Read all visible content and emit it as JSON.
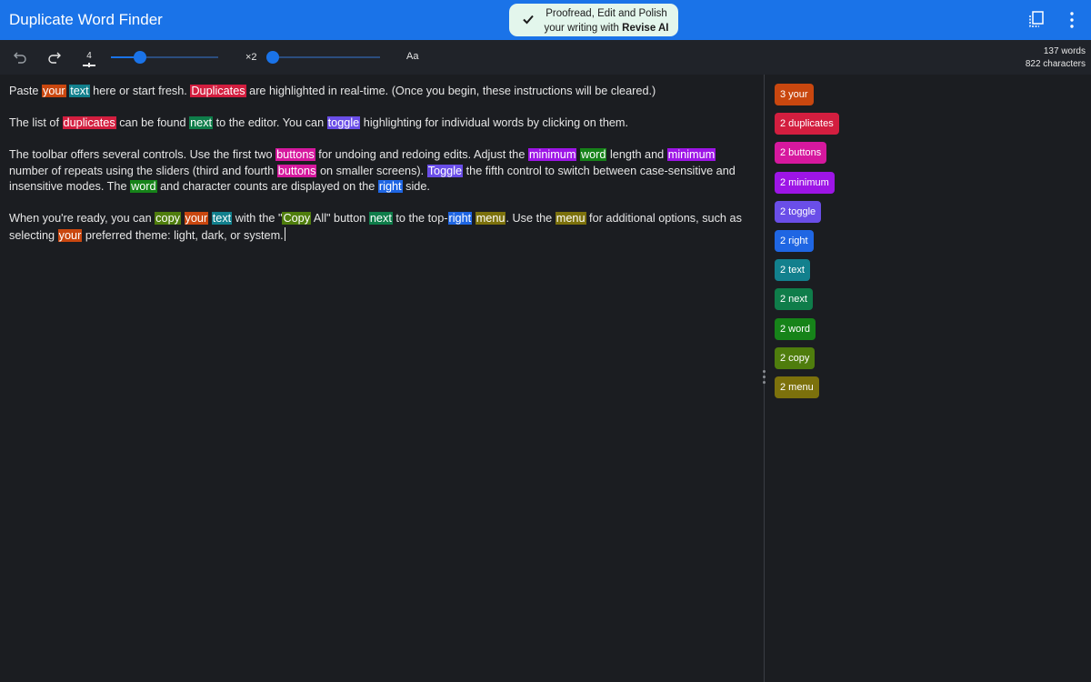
{
  "app": {
    "title": "Duplicate Word Finder"
  },
  "promo": {
    "line1": "Proofread, Edit and Polish",
    "line2_prefix": "your writing with ",
    "line2_brand": "Revise AI"
  },
  "header": {
    "icons": [
      "copy-all-icon",
      "more-vert-icon"
    ]
  },
  "toolbar": {
    "min_word_length": "4",
    "min_word_length_fraction": 0.27,
    "repeat_label": "×2",
    "min_repeats_fraction": 0.0,
    "case_toggle_label": "Aa",
    "word_count": "137 words",
    "char_count": "822 characters"
  },
  "colors": {
    "your": "#c9470f",
    "duplicates": "#d31e3f",
    "buttons": "#d6189e",
    "minimum": "#9d15e6",
    "toggle": "#6a4ee8",
    "right": "#1f66e3",
    "text": "#12808d",
    "next": "#0f7d4a",
    "word": "#168319",
    "copy": "#4f7d0d",
    "menu": "#7c710c",
    "header": "#1a73e8",
    "background": "#1b1d21"
  },
  "editor": {
    "paragraphs": [
      [
        {
          "t": "Paste "
        },
        {
          "t": "your",
          "w": "your"
        },
        {
          "t": " "
        },
        {
          "t": "text",
          "w": "text"
        },
        {
          "t": " here or start fresh. "
        },
        {
          "t": "Duplicates",
          "w": "duplicates"
        },
        {
          "t": " are highlighted in real-time. (Once you begin, these instructions will be cleared.)"
        }
      ],
      [
        {
          "t": "The list of "
        },
        {
          "t": "duplicates",
          "w": "duplicates"
        },
        {
          "t": " can be found "
        },
        {
          "t": "next",
          "w": "next"
        },
        {
          "t": " to the editor. You can "
        },
        {
          "t": "toggle",
          "w": "toggle"
        },
        {
          "t": " highlighting for individual words by clicking on them."
        }
      ],
      [
        {
          "t": "The toolbar offers several controls. Use the first two "
        },
        {
          "t": "buttons",
          "w": "buttons"
        },
        {
          "t": " for undoing and redoing edits. Adjust the "
        },
        {
          "t": "minimum",
          "w": "minimum"
        },
        {
          "t": " "
        },
        {
          "t": "word",
          "w": "word"
        },
        {
          "t": " length and "
        },
        {
          "t": "minimum",
          "w": "minimum"
        },
        {
          "t": " number of repeats using the sliders (third and fourth "
        },
        {
          "t": "buttons",
          "w": "buttons"
        },
        {
          "t": " on smaller screens). "
        },
        {
          "t": "Toggle",
          "w": "toggle"
        },
        {
          "t": " the fifth control to switch between case-sensitive and insensitive modes. The "
        },
        {
          "t": "word",
          "w": "word"
        },
        {
          "t": " and character counts are displayed on the "
        },
        {
          "t": "right",
          "w": "right"
        },
        {
          "t": " side."
        }
      ],
      [
        {
          "t": "When you're ready, you can "
        },
        {
          "t": "copy",
          "w": "copy"
        },
        {
          "t": " "
        },
        {
          "t": "your",
          "w": "your"
        },
        {
          "t": " "
        },
        {
          "t": "text",
          "w": "text"
        },
        {
          "t": " with the \""
        },
        {
          "t": "Copy",
          "w": "copy"
        },
        {
          "t": " All\" button "
        },
        {
          "t": "next",
          "w": "next"
        },
        {
          "t": " to the top-"
        },
        {
          "t": "right",
          "w": "right"
        },
        {
          "t": " "
        },
        {
          "t": "menu",
          "w": "menu"
        },
        {
          "t": ". Use the "
        },
        {
          "t": "menu",
          "w": "menu"
        },
        {
          "t": " for additional options, such as selecting "
        },
        {
          "t": "your",
          "w": "your"
        },
        {
          "t": " preferred theme: light, dark, or system."
        }
      ]
    ]
  },
  "duplicates": [
    {
      "label": "3 your",
      "word": "your"
    },
    {
      "label": "2 duplicates",
      "word": "duplicates"
    },
    {
      "label": "2 buttons",
      "word": "buttons"
    },
    {
      "label": "2 minimum",
      "word": "minimum"
    },
    {
      "label": "2 toggle",
      "word": "toggle"
    },
    {
      "label": "2 right",
      "word": "right"
    },
    {
      "label": "2 text",
      "word": "text"
    },
    {
      "label": "2 next",
      "word": "next"
    },
    {
      "label": "2 word",
      "word": "word"
    },
    {
      "label": "2 copy",
      "word": "copy"
    },
    {
      "label": "2 menu",
      "word": "menu"
    }
  ]
}
